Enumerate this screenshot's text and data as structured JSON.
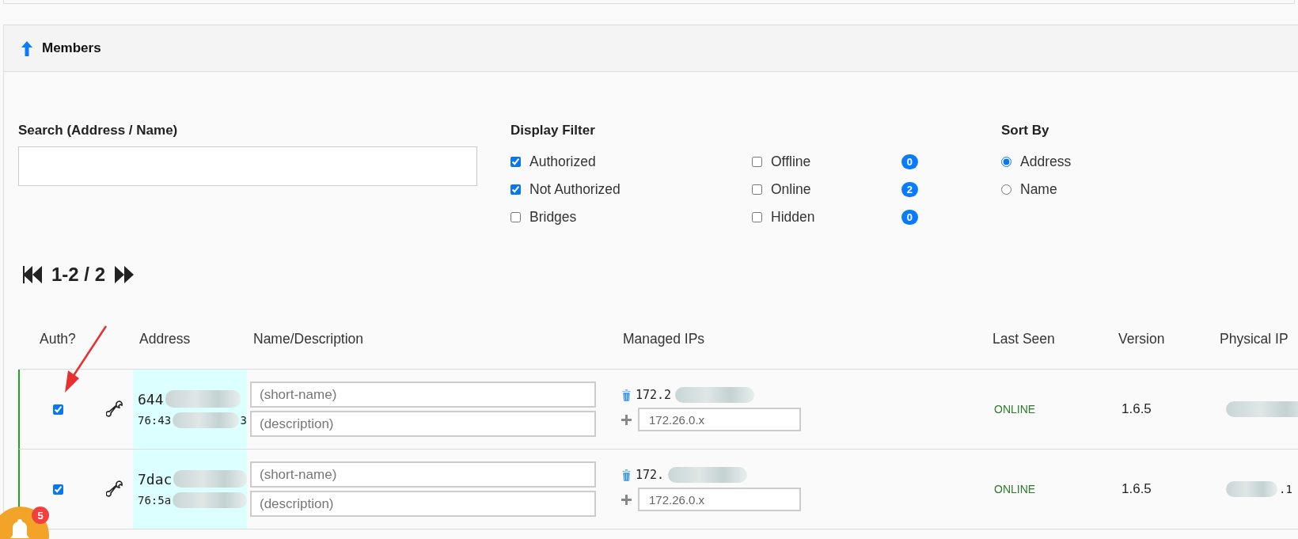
{
  "panel": {
    "title": "Members"
  },
  "search": {
    "label": "Search (Address / Name)"
  },
  "display_filter": {
    "title": "Display Filter",
    "options": [
      {
        "label": "Authorized",
        "checked": true
      },
      {
        "label": "Not Authorized",
        "checked": true
      },
      {
        "label": "Bridges",
        "checked": false
      },
      {
        "label": "Offline",
        "checked": false,
        "count": "0"
      },
      {
        "label": "Online",
        "checked": false,
        "count": "2"
      },
      {
        "label": "Hidden",
        "checked": false,
        "count": "0"
      }
    ]
  },
  "sort_by": {
    "title": "Sort By",
    "options": [
      {
        "label": "Address",
        "selected": true
      },
      {
        "label": "Name",
        "selected": false
      }
    ]
  },
  "pager": {
    "range": "1-2 / 2"
  },
  "table": {
    "columns": [
      "Auth?",
      "Address",
      "Name/Description",
      "Managed IPs",
      "Last Seen",
      "Version",
      "Physical IP"
    ],
    "rows": [
      {
        "authorized": true,
        "address": "644",
        "mac": "76:43",
        "mac_tail": "3",
        "name_placeholder": "(short-name)",
        "description_placeholder": "(description)",
        "ip": "172.2",
        "ip_placeholder": "172.26.0.x",
        "last_seen": "ONLINE",
        "version": "1.6.5"
      },
      {
        "authorized": true,
        "address": "7dac",
        "mac": "76:5a",
        "name_placeholder": "(short-name)",
        "description_placeholder": "(description)",
        "ip": "172.",
        "ip_placeholder": "172.26.0.x",
        "last_seen": "ONLINE",
        "version": "1.6.5",
        "physical_ip": ".1"
      }
    ]
  },
  "notifications": {
    "count": "5"
  }
}
